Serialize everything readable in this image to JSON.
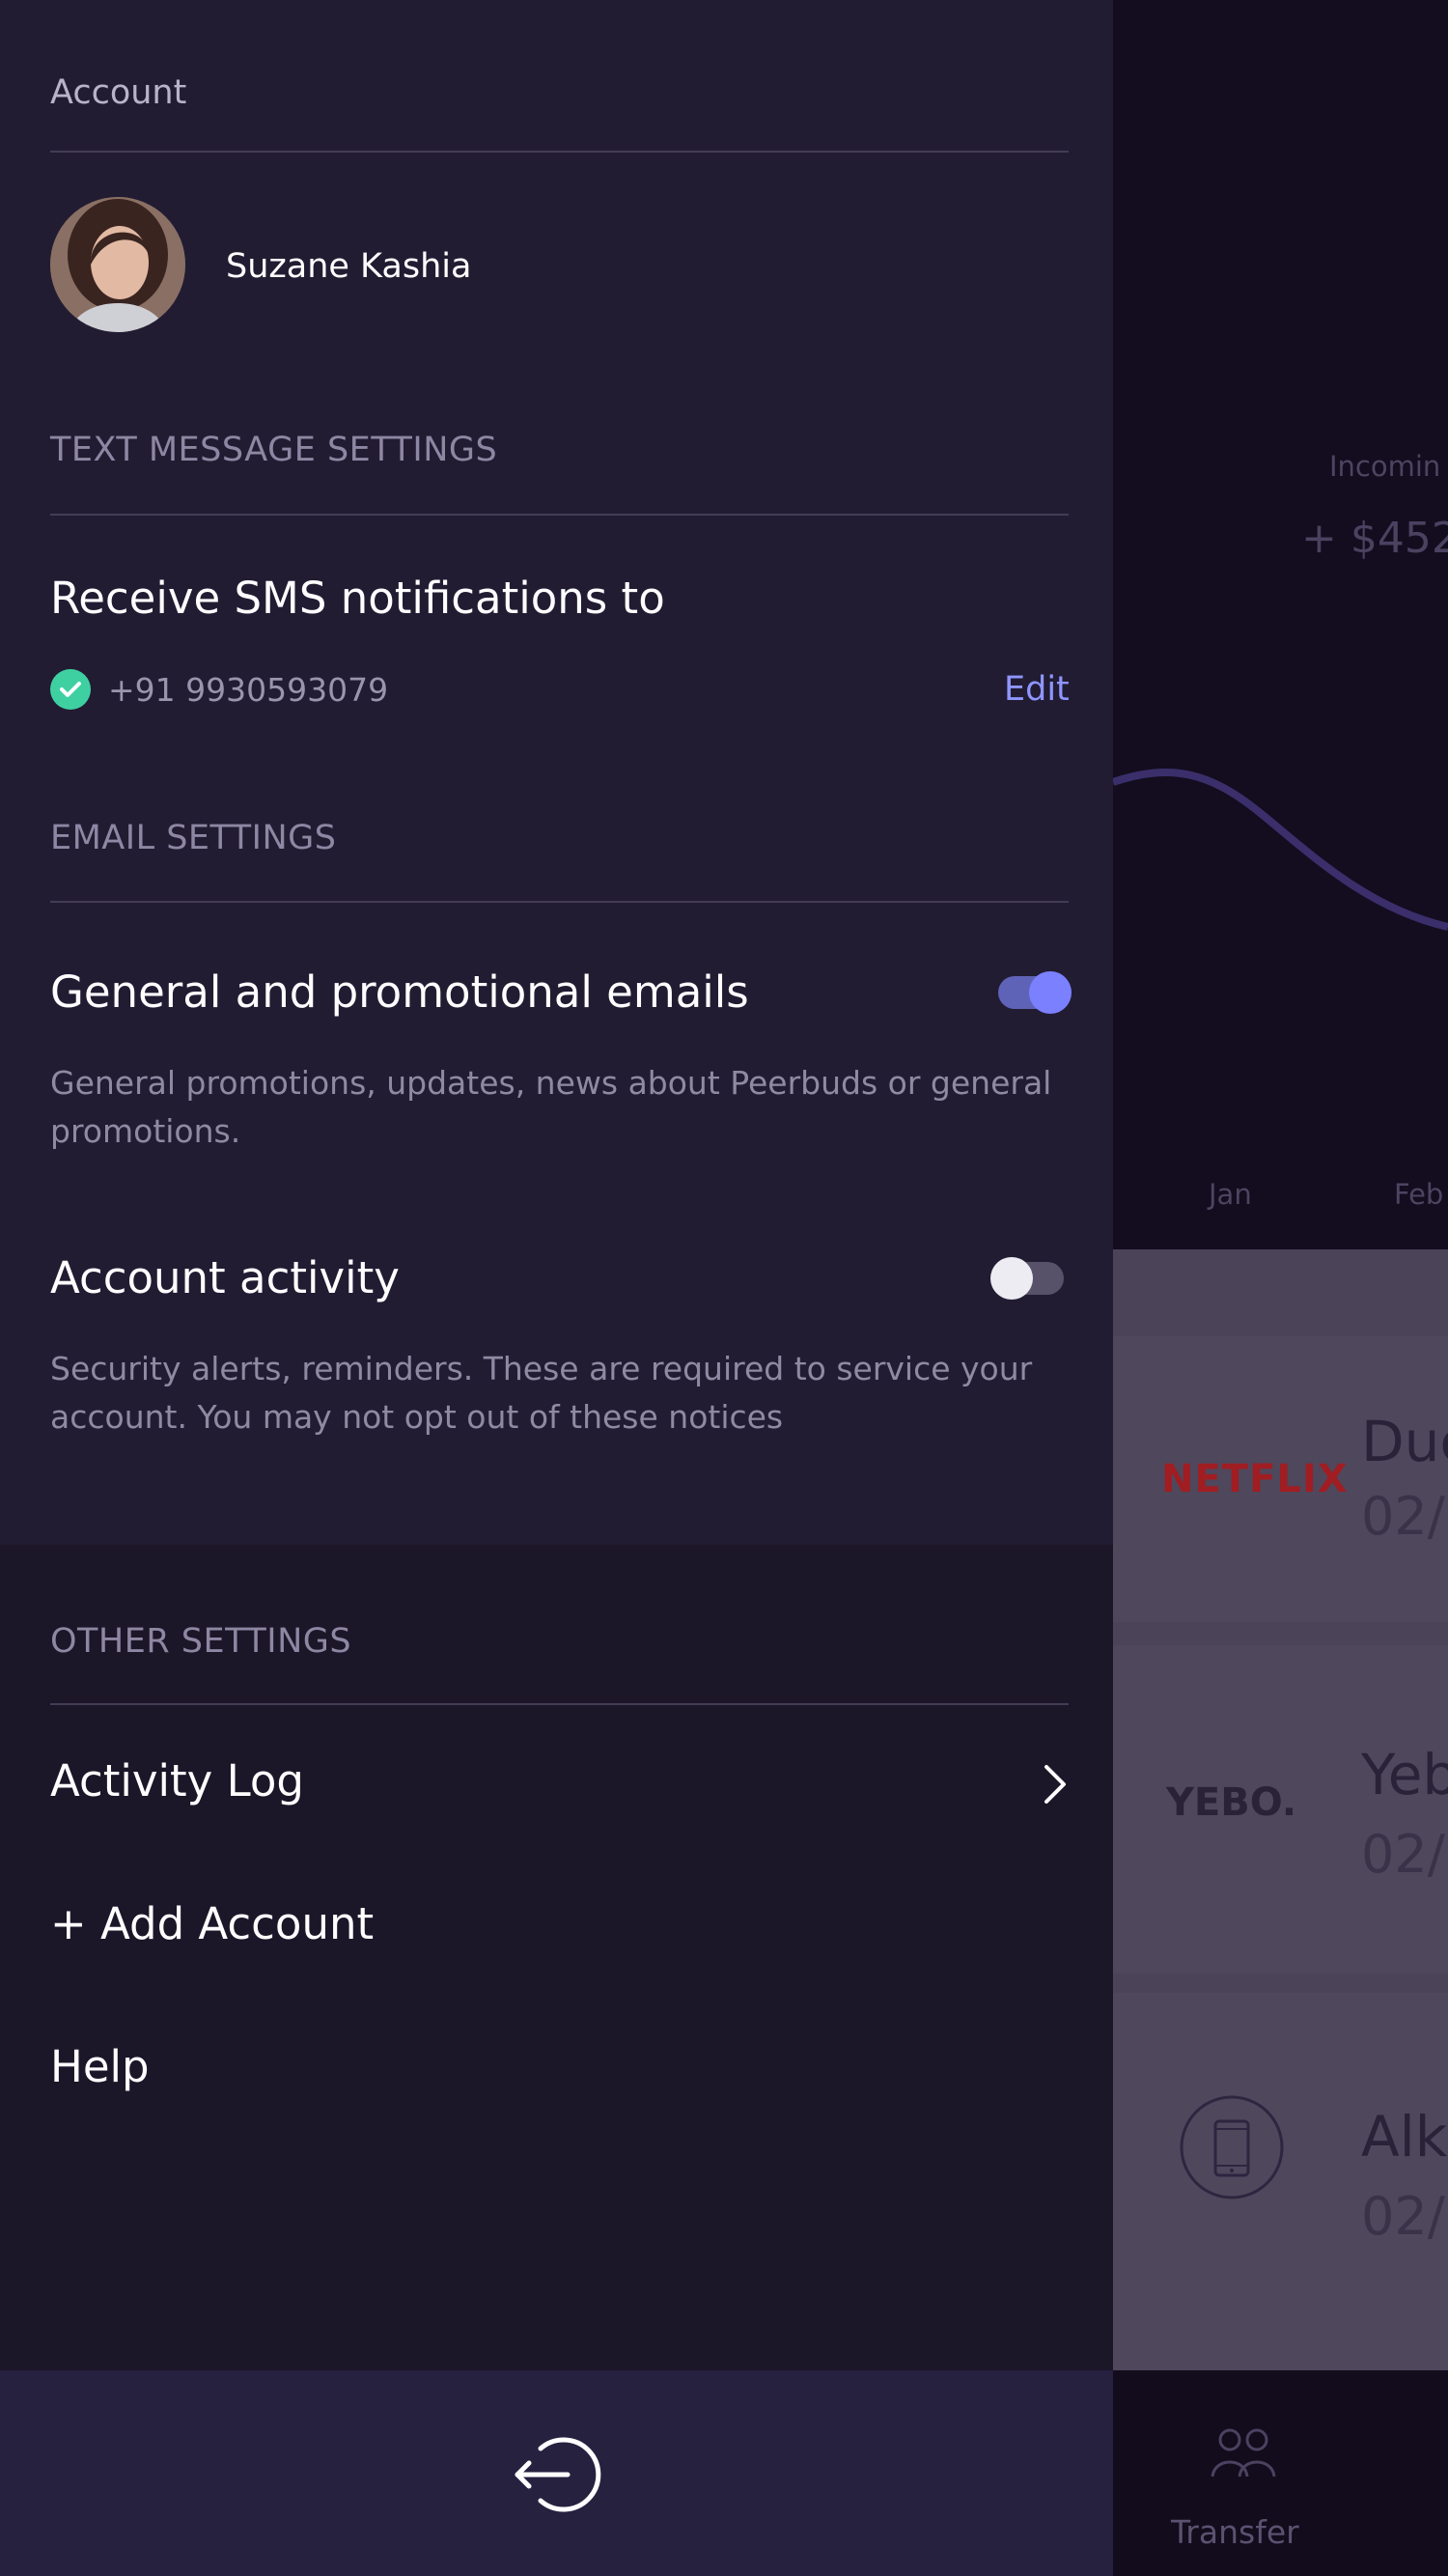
{
  "background_app": {
    "incoming_label": "Incomin",
    "incoming_amount": "+ $452",
    "months": [
      "Jan",
      "Feb"
    ],
    "transactions": [
      {
        "logo": "NETFLIX",
        "title": "Duc",
        "date": "02/"
      },
      {
        "logo": "YEBO.",
        "title": "Yeb",
        "date": "02/"
      },
      {
        "logo": "phone-icon",
        "title": "Alk",
        "date": "02/"
      }
    ],
    "tab_label": "Transfer"
  },
  "drawer": {
    "account_label": "Account",
    "user": {
      "name": "Suzane Kashia"
    },
    "text_message_settings": {
      "section_label": "TEXT MESSAGE SETTINGS",
      "title": "Receive SMS notifications to",
      "phone": "+91 9930593079",
      "edit_label": "Edit"
    },
    "email_settings": {
      "section_label": "EMAIL SETTINGS",
      "promotional": {
        "title": "General and promotional emails",
        "description": "General promotions, updates, news about Peerbuds or general promotions.",
        "enabled": true
      },
      "account_activity": {
        "title": "Account activity",
        "description": "Security alerts, reminders. These are required to service your account. You may not opt out of these notices",
        "enabled": false
      }
    },
    "other_settings": {
      "section_label": "OTHER SETTINGS",
      "activity_log": "Activity Log",
      "add_account": "+ Add Account",
      "help": "Help"
    }
  },
  "colors": {
    "drawer_bg": "#221c33",
    "accent": "#8f96ff",
    "toggle_on": "#7b80ff",
    "check_green": "#3fd0a2"
  }
}
